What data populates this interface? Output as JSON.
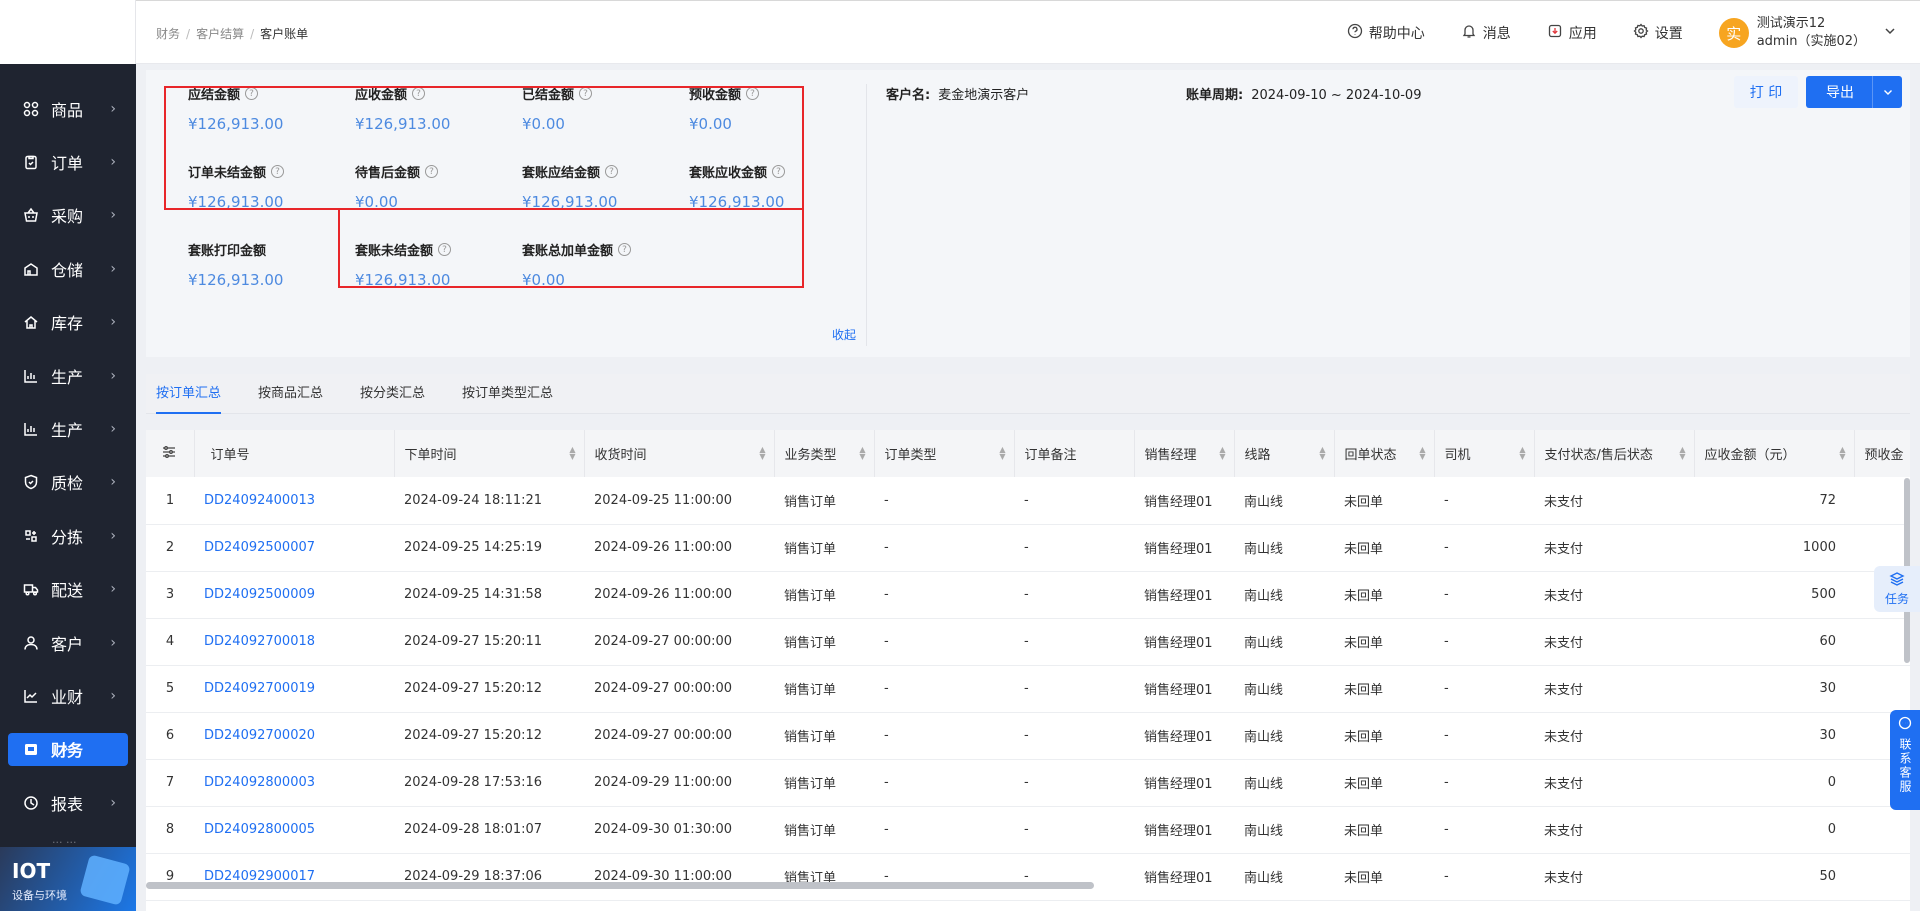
{
  "sidebar": {
    "items": [
      {
        "label": "商品",
        "icon": "grid-icon"
      },
      {
        "label": "订单",
        "icon": "clipboard-icon"
      },
      {
        "label": "采购",
        "icon": "basket-icon"
      },
      {
        "label": "仓储",
        "icon": "warehouse-icon"
      },
      {
        "label": "库存",
        "icon": "home-icon"
      },
      {
        "label": "生产",
        "icon": "chart-icon"
      },
      {
        "label": "生产",
        "icon": "chart-icon"
      },
      {
        "label": "质检",
        "icon": "shield-icon"
      },
      {
        "label": "分拣",
        "icon": "sort-icon"
      },
      {
        "label": "配送",
        "icon": "truck-icon"
      },
      {
        "label": "客户",
        "icon": "user-icon"
      },
      {
        "label": "业财",
        "icon": "finance-chart-icon"
      },
      {
        "label": "财务",
        "icon": "wallet-icon",
        "active": true
      },
      {
        "label": "报表",
        "icon": "clock-icon"
      }
    ],
    "partial_label": "... ...",
    "iot": {
      "title": "IOT",
      "subtitle": "设备与环境"
    }
  },
  "breadcrumb": {
    "level1": "财务",
    "level2": "客户结算",
    "current": "客户账单"
  },
  "topbar": {
    "help": "帮助中心",
    "messages": "消息",
    "apps": "应用",
    "settings": "设置",
    "user": {
      "avatar_char": "实",
      "name": "测试演示12",
      "account": "admin（实施02）"
    }
  },
  "summary": {
    "amounts": [
      {
        "label": "应结金额",
        "value": "¥126,913.00"
      },
      {
        "label": "应收金额",
        "value": "¥126,913.00"
      },
      {
        "label": "已结金额",
        "value": "¥0.00"
      },
      {
        "label": "预收金额",
        "value": "¥0.00"
      },
      {
        "label": "订单未结金额",
        "value": "¥126,913.00"
      },
      {
        "label": "待售后金额",
        "value": "¥0.00"
      },
      {
        "label": "套账应结金额",
        "value": "¥126,913.00"
      },
      {
        "label": "套账应收金额",
        "value": "¥126,913.00"
      },
      {
        "label": "套账打印金额",
        "value": "¥126,913.00"
      },
      {
        "label": "套账未结金额",
        "value": "¥126,913.00"
      },
      {
        "label": "套账总加单金额",
        "value": "¥0.00"
      }
    ],
    "collapse": "收起",
    "customer_label": "客户名:",
    "customer_name": "麦金地演示客户",
    "period_label": "账单周期:",
    "period_value": "2024-09-10 ~ 2024-10-09",
    "print": "打 印",
    "export": "导出"
  },
  "tabs": [
    {
      "label": "按订单汇总",
      "active": true
    },
    {
      "label": "按商品汇总"
    },
    {
      "label": "按分类汇总"
    },
    {
      "label": "按订单类型汇总"
    }
  ],
  "table": {
    "columns": [
      "订单号",
      "下单时间",
      "收货时间",
      "业务类型",
      "订单类型",
      "订单备注",
      "销售经理",
      "线路",
      "回单状态",
      "司机",
      "支付状态/售后状态",
      "应收金额（元）",
      "预收金"
    ],
    "rows": [
      {
        "idx": "1",
        "order_no": "DD24092400013",
        "order_time": "2024-09-24 18:11:21",
        "receive_time": "2024-09-25 11:00:00",
        "biz_type": "销售订单",
        "order_type": "-",
        "remark": "-",
        "manager": "销售经理01",
        "route": "南山线",
        "receipt": "未回单",
        "driver": "-",
        "pay_status": "未支付",
        "amount": "72"
      },
      {
        "idx": "2",
        "order_no": "DD24092500007",
        "order_time": "2024-09-25 14:25:19",
        "receive_time": "2024-09-26 11:00:00",
        "biz_type": "销售订单",
        "order_type": "-",
        "remark": "-",
        "manager": "销售经理01",
        "route": "南山线",
        "receipt": "未回单",
        "driver": "-",
        "pay_status": "未支付",
        "amount": "1000"
      },
      {
        "idx": "3",
        "order_no": "DD24092500009",
        "order_time": "2024-09-25 14:31:58",
        "receive_time": "2024-09-26 11:00:00",
        "biz_type": "销售订单",
        "order_type": "-",
        "remark": "-",
        "manager": "销售经理01",
        "route": "南山线",
        "receipt": "未回单",
        "driver": "-",
        "pay_status": "未支付",
        "amount": "500"
      },
      {
        "idx": "4",
        "order_no": "DD24092700018",
        "order_time": "2024-09-27 15:20:11",
        "receive_time": "2024-09-27 00:00:00",
        "biz_type": "销售订单",
        "order_type": "-",
        "remark": "-",
        "manager": "销售经理01",
        "route": "南山线",
        "receipt": "未回单",
        "driver": "-",
        "pay_status": "未支付",
        "amount": "60"
      },
      {
        "idx": "5",
        "order_no": "DD24092700019",
        "order_time": "2024-09-27 15:20:12",
        "receive_time": "2024-09-27 00:00:00",
        "biz_type": "销售订单",
        "order_type": "-",
        "remark": "-",
        "manager": "销售经理01",
        "route": "南山线",
        "receipt": "未回单",
        "driver": "-",
        "pay_status": "未支付",
        "amount": "30"
      },
      {
        "idx": "6",
        "order_no": "DD24092700020",
        "order_time": "2024-09-27 15:20:12",
        "receive_time": "2024-09-27 00:00:00",
        "biz_type": "销售订单",
        "order_type": "-",
        "remark": "-",
        "manager": "销售经理01",
        "route": "南山线",
        "receipt": "未回单",
        "driver": "-",
        "pay_status": "未支付",
        "amount": "30"
      },
      {
        "idx": "7",
        "order_no": "DD24092800003",
        "order_time": "2024-09-28 17:53:16",
        "receive_time": "2024-09-29 11:00:00",
        "biz_type": "销售订单",
        "order_type": "-",
        "remark": "-",
        "manager": "销售经理01",
        "route": "南山线",
        "receipt": "未回单",
        "driver": "-",
        "pay_status": "未支付",
        "amount": "0"
      },
      {
        "idx": "8",
        "order_no": "DD24092800005",
        "order_time": "2024-09-28 18:01:07",
        "receive_time": "2024-09-30 01:30:00",
        "biz_type": "销售订单",
        "order_type": "-",
        "remark": "-",
        "manager": "销售经理01",
        "route": "南山线",
        "receipt": "未回单",
        "driver": "-",
        "pay_status": "未支付",
        "amount": "0"
      },
      {
        "idx": "9",
        "order_no": "DD24092900017",
        "order_time": "2024-09-29 18:37:06",
        "receive_time": "2024-09-30 11:00:00",
        "biz_type": "销售订单",
        "order_type": "-",
        "remark": "-",
        "manager": "销售经理01",
        "route": "南山线",
        "receipt": "未回单",
        "driver": "-",
        "pay_status": "未支付",
        "amount": "50"
      }
    ]
  },
  "floating": {
    "task": "任务",
    "service": "联系客服"
  },
  "colors": {
    "accent": "#1f6ff2",
    "highlight_box": "#e8262a",
    "sidebar_bg": "#1f2430",
    "amount_blue": "#4d8ae0"
  }
}
